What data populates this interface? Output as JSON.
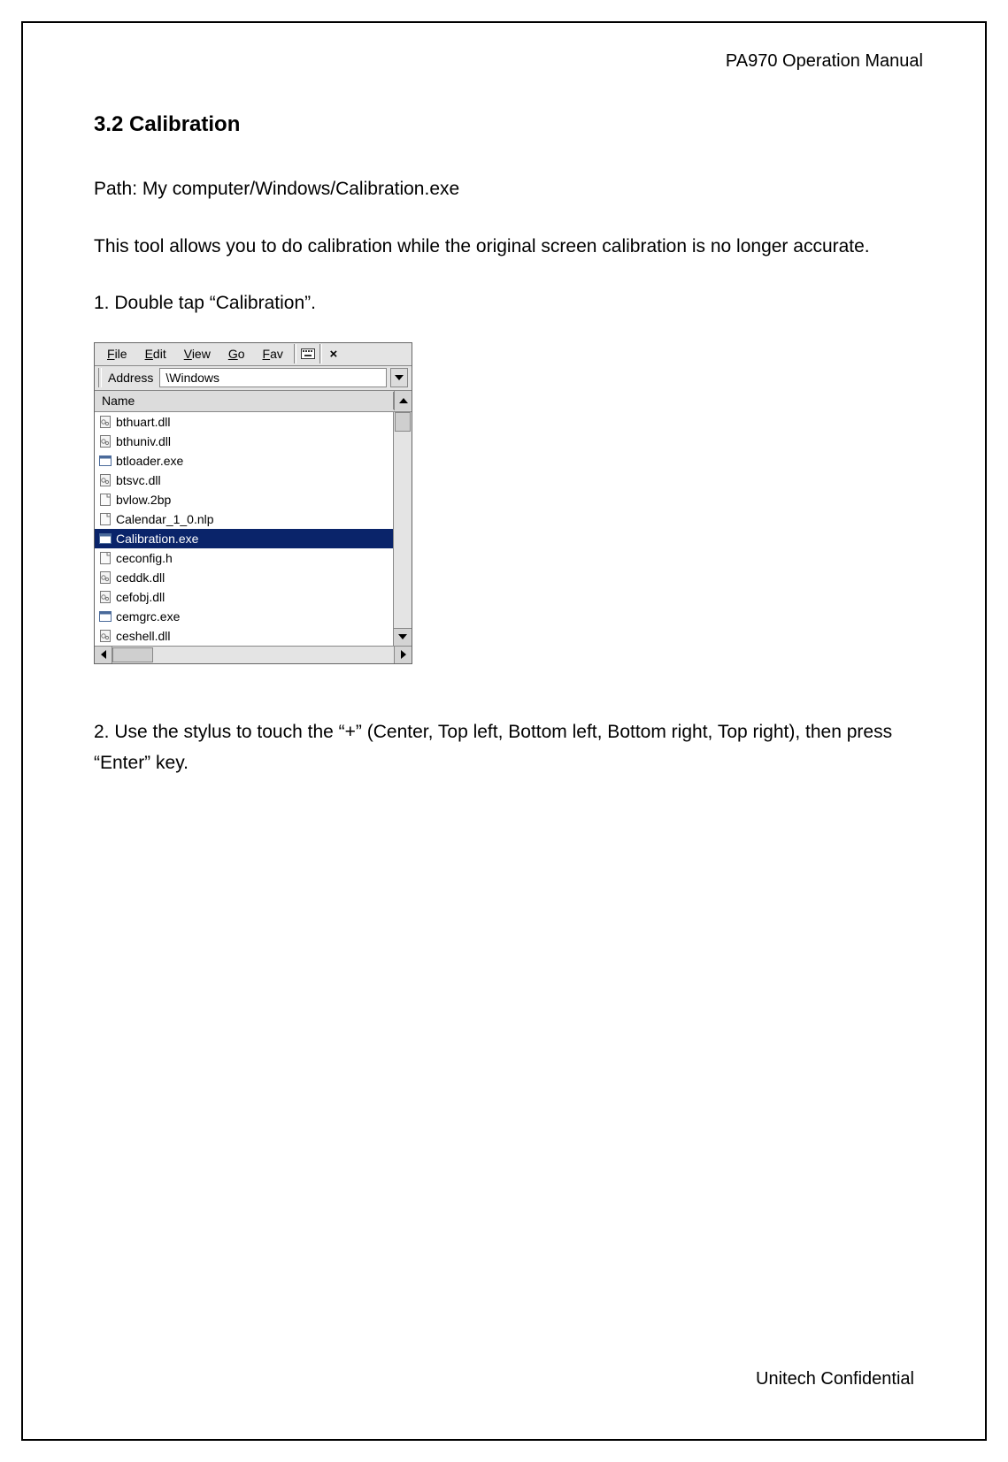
{
  "header": {
    "doc_title": "PA970 Operation Manual"
  },
  "section": {
    "title": "3.2 Calibration"
  },
  "body": {
    "path_line": "Path: My computer/Windows/Calibration.exe",
    "intro": "This tool allows you to do calibration while the original screen calibration is no longer accurate.",
    "step1": "1. Double tap “Calibration”.",
    "step2": "2. Use the stylus to touch the “+” (Center, Top left, Bottom left, Bottom right, Top right), then press “Enter” key."
  },
  "explorer": {
    "menus": {
      "file": "File",
      "edit": "Edit",
      "view": "View",
      "go": "Go",
      "fav": "Fav"
    },
    "toolbar": {
      "keyboard_tip": "⌨",
      "close": "×"
    },
    "address": {
      "label": "Address",
      "value": "\\Windows"
    },
    "column": {
      "name": "Name"
    },
    "files": [
      {
        "name": "bthuart.dll",
        "type": "dll",
        "selected": false
      },
      {
        "name": "bthuniv.dll",
        "type": "dll",
        "selected": false
      },
      {
        "name": "btloader.exe",
        "type": "exe",
        "selected": false
      },
      {
        "name": "btsvc.dll",
        "type": "dll",
        "selected": false
      },
      {
        "name": "bvlow.2bp",
        "type": "generic",
        "selected": false
      },
      {
        "name": "Calendar_1_0.nlp",
        "type": "generic",
        "selected": false
      },
      {
        "name": "Calibration.exe",
        "type": "exe",
        "selected": true
      },
      {
        "name": "ceconfig.h",
        "type": "generic",
        "selected": false
      },
      {
        "name": "ceddk.dll",
        "type": "dll",
        "selected": false
      },
      {
        "name": "cefobj.dll",
        "type": "dll",
        "selected": false
      },
      {
        "name": "cemgrc.exe",
        "type": "exe",
        "selected": false
      },
      {
        "name": "ceshell.dll",
        "type": "dll",
        "selected": false
      }
    ]
  },
  "footer": {
    "text": "Unitech Confidential"
  }
}
